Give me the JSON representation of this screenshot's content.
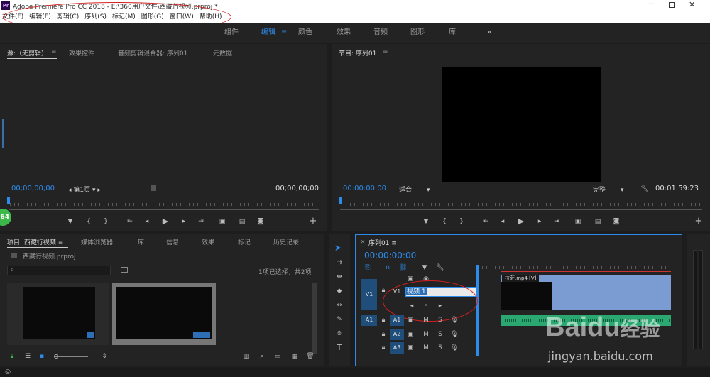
{
  "title_bar": {
    "app_title": "Adobe Premiere Pro CC 2018 - E:\\360用户文件\\西藏行视频.prproj *"
  },
  "menu": [
    "文件(F)",
    "编辑(E)",
    "剪辑(C)",
    "序列(S)",
    "标记(M)",
    "图形(G)",
    "窗口(W)",
    "帮助(H)"
  ],
  "workspaces": [
    "组件",
    "编辑",
    "颜色",
    "效果",
    "音频",
    "图形",
    "库"
  ],
  "source_panel": {
    "tabs": [
      "源:（无剪辑）",
      "效果控件",
      "音频剪辑混合器: 序列01",
      "元数据"
    ],
    "tc_left": "00;00;00;00",
    "page": "第1页",
    "tc_right": "00;00;00;00"
  },
  "program_panel": {
    "tab": "节目: 序列01",
    "tc_left": "00:00:00:00",
    "fit": "适合",
    "quality": "完整",
    "tc_right": "00:01:59:23"
  },
  "project_panel": {
    "tabs": [
      "项目: 西藏行视频",
      "媒体浏览器",
      "库",
      "信息",
      "效果",
      "标记",
      "历史记录"
    ],
    "file": "西藏行视频.prproj",
    "selection": "1项已选择，共2项"
  },
  "timeline": {
    "tab": "序列01",
    "tc": "00:00:00:00",
    "v1": "V1",
    "v1_label": "V1",
    "a_tracks": [
      "A1",
      "A2",
      "A3"
    ],
    "rename_value": "视频 1",
    "clip_name": "拉萨.mp4 [V]",
    "m": "M",
    "s": "S"
  },
  "badge": "64",
  "watermark": {
    "brand": "Baidu",
    "cn": "经验",
    "url": "jingyan.baidu.com"
  }
}
